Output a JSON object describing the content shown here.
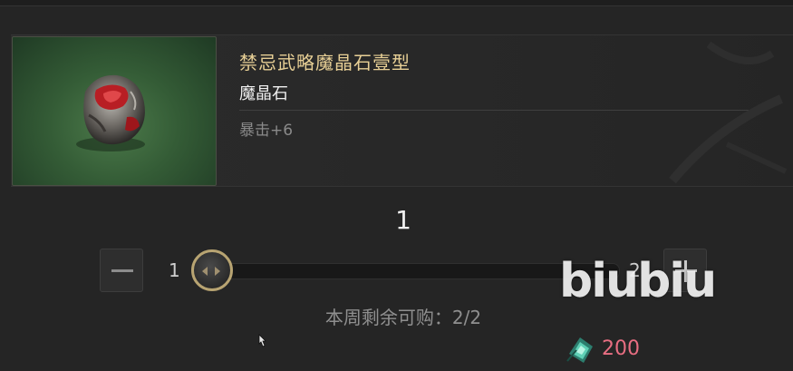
{
  "item": {
    "name": "禁忌武略魔晶石壹型",
    "type": "魔晶石",
    "stat": "暴击+6",
    "icon": "magic-crystal-icon"
  },
  "purchase": {
    "quantity": "1",
    "slider_min": "1",
    "slider_max": "2",
    "slider_value_fraction": 0.0,
    "weekly_remaining": "本周剩余可购：2/2",
    "price": "200",
    "currency_icon": "green-crystal-currency-icon"
  },
  "colors": {
    "item_name": "#e7cf95",
    "price": "#e86e82",
    "slider_thumb_ring": "#b8a472"
  },
  "watermark": "biubiu"
}
